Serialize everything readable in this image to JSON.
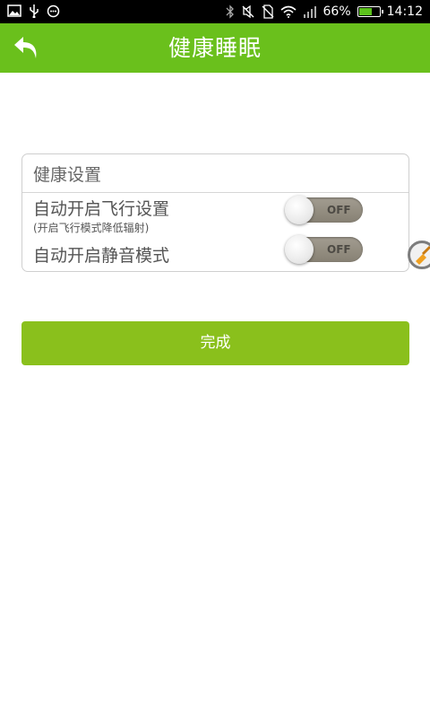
{
  "status_bar": {
    "battery_percent": "66%",
    "battery_level": 0.66,
    "time": "14:12",
    "icons": [
      "image-icon",
      "usb-icon",
      "chat-icon",
      "bluetooth-icon",
      "vibrate-off-icon",
      "no-sim-icon",
      "wifi-icon",
      "signal-icon",
      "battery-icon"
    ]
  },
  "header": {
    "title": "健康睡眠",
    "back_icon": "back-arrow-icon"
  },
  "settings": {
    "section_title": "健康设置",
    "items": [
      {
        "label": "自动开启飞行设置",
        "sublabel": "(开启飞行模式降低辐射)",
        "toggle": "OFF"
      },
      {
        "label": "自动开启静音模式",
        "toggle": "OFF"
      }
    ]
  },
  "done_button": "完成",
  "colors": {
    "header_green": "#6ac01c",
    "button_green": "#8ac01c",
    "toggle_off": "#8f897c"
  }
}
